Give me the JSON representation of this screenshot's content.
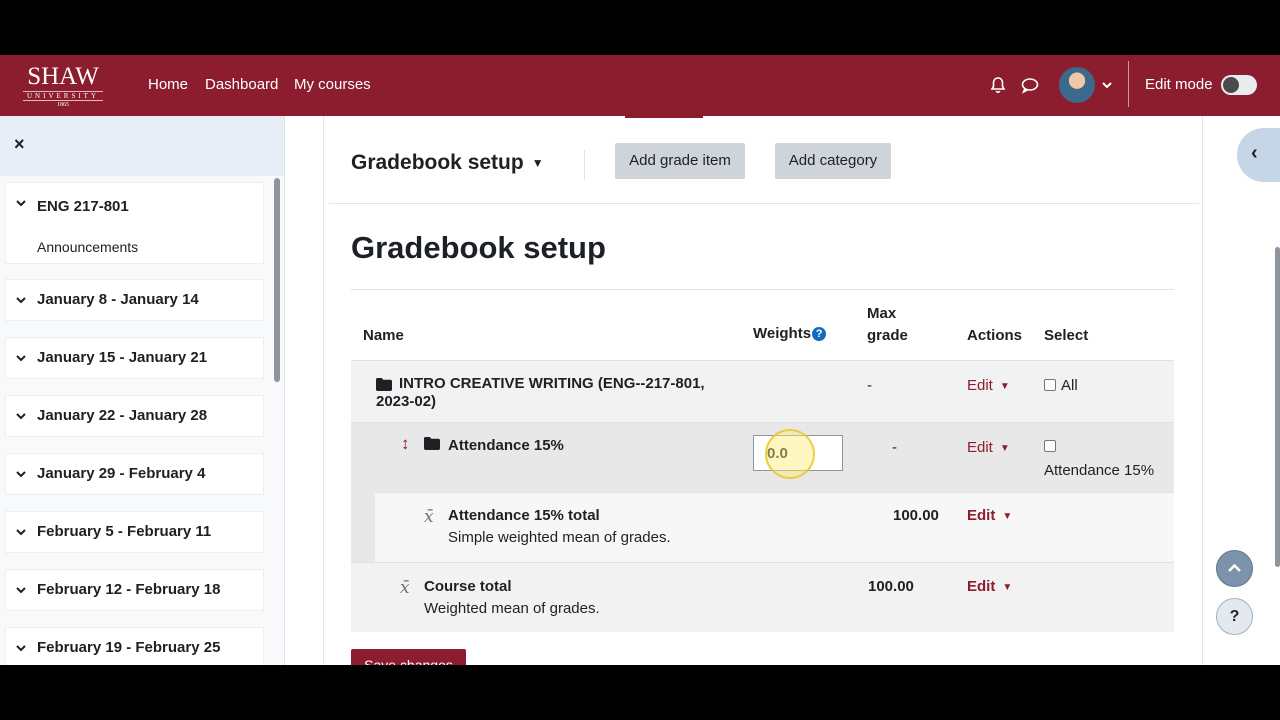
{
  "navbar": {
    "logo": {
      "line1": "SHAW",
      "line2": "UNIVERSITY",
      "line3": "1865"
    },
    "links": [
      "Home",
      "Dashboard",
      "My courses"
    ],
    "icons": [
      "bell-icon",
      "chat-bubble-icon"
    ],
    "edit_mode_label": "Edit mode",
    "edit_mode_on": false
  },
  "drawer": {
    "close_label": "×",
    "sections": [
      {
        "title": "ENG 217-801",
        "items": [
          "Announcements"
        ]
      },
      {
        "title": "January 8 - January 14"
      },
      {
        "title": "January 15 - January 21"
      },
      {
        "title": "January 22 - January 28"
      },
      {
        "title": "January 29 - February 4"
      },
      {
        "title": "February 5 - February 11"
      },
      {
        "title": "February 12 - February 18"
      },
      {
        "title": "February 19 - February 25"
      }
    ]
  },
  "toolbar": {
    "select_title": "Gradebook setup",
    "add_grade_item": "Add grade item",
    "add_category": "Add category"
  },
  "page_title": "Gradebook setup",
  "table": {
    "headers": {
      "name": "Name",
      "weights": "Weights",
      "weights_help": "?",
      "max_grade_1": "Max",
      "max_grade_2": "grade",
      "actions": "Actions",
      "select": "Select"
    },
    "category_row": {
      "name_1": "INTRO CREATIVE WRITING (ENG--217-801,",
      "name_2": "2023-02)",
      "max_grade": "-",
      "action": "Edit",
      "select_label": "All"
    },
    "attendance_row": {
      "name": "Attendance 15%",
      "weight_value": "0.0",
      "max_grade": "-",
      "action": "Edit",
      "select_label": "Attendance 15%"
    },
    "attendance_total_row": {
      "name": "Attendance 15% total",
      "sub": "Simple weighted mean of grades.",
      "max_grade": "100.00",
      "action": "Edit"
    },
    "course_total_row": {
      "name": "Course total",
      "sub": "Weighted mean of grades.",
      "max_grade": "100.00",
      "action": "Edit"
    }
  },
  "save_button": "Save changes",
  "help_button": "?",
  "colors": {
    "brand": "#8c1d2e",
    "link": "#8c1d2e",
    "help": "#0f6cbf"
  }
}
